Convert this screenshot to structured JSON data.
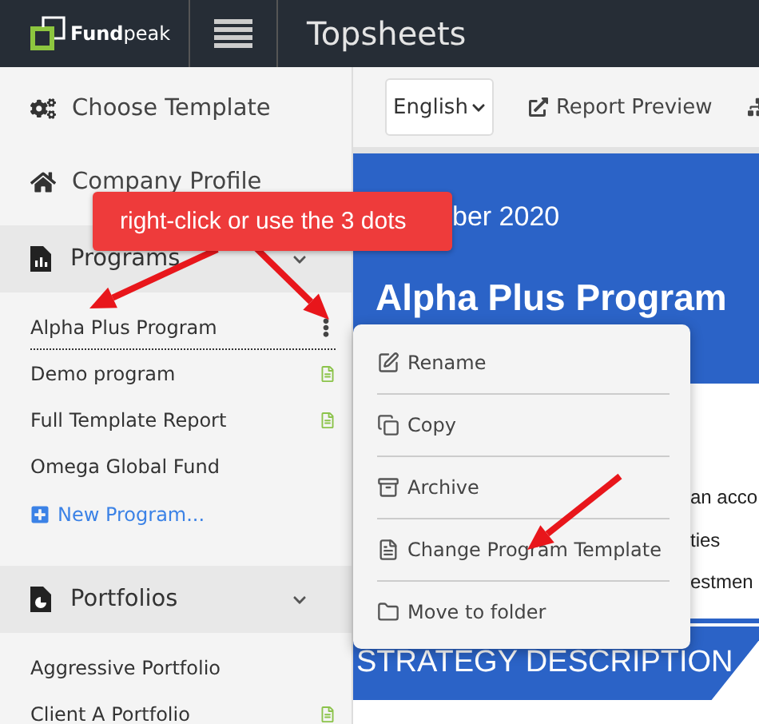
{
  "header": {
    "logo": "**Fund**peak",
    "title": "Topsheets"
  },
  "sidebar": {
    "nav": [
      {
        "label": "Choose Template"
      },
      {
        "label": "Company Profile"
      }
    ],
    "sections": [
      {
        "title": "Programs",
        "expanded": true,
        "items": [
          {
            "label": "Alpha Plus Program",
            "selected": true,
            "report": false
          },
          {
            "label": "Demo program",
            "selected": false,
            "report": true
          },
          {
            "label": "Full Template Report",
            "selected": false,
            "report": true
          },
          {
            "label": "Omega Global Fund",
            "selected": false,
            "report": false
          }
        ],
        "add_link": "New Program..."
      },
      {
        "title": "Portfolios",
        "expanded": true,
        "items": [
          {
            "label": "Aggressive Portfolio",
            "selected": false,
            "report": false
          },
          {
            "label": "Client A Portfolio",
            "selected": false,
            "report": true
          }
        ]
      }
    ]
  },
  "toolbar": {
    "language": "English",
    "preview": "Report Preview"
  },
  "report": {
    "date": "ber 2020",
    "title": "Alpha Plus Program",
    "lines": [
      "an acco",
      "ties",
      "estmen"
    ],
    "section": "STRATEGY DESCRIPTION"
  },
  "context_menu": {
    "items": [
      "Rename",
      "Copy",
      "Archive",
      "Change Program Template",
      "Move to folder"
    ]
  },
  "callout": {
    "text": "right-click or use the 3 dots"
  }
}
